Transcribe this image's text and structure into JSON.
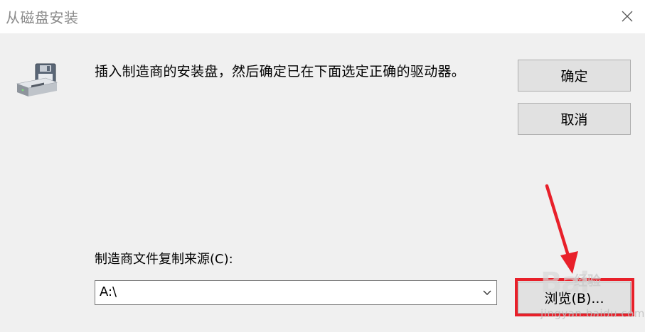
{
  "window": {
    "title": "从磁盘安装"
  },
  "icons": {
    "close": "close-icon",
    "disk": "floppy-disk-drive-icon",
    "dropdown": "chevron-down-icon"
  },
  "dialog": {
    "instruction": "插入制造商的安装盘，然后确定已在下面选定正确的驱动器。",
    "ok_label": "确定",
    "cancel_label": "取消",
    "source_label": "制造商文件复制来源(C):",
    "source_value": "A:\\",
    "browse_label": "浏览(B)..."
  },
  "annotation": {
    "highlight_color": "#e8202a",
    "arrow_color": "#e8202a"
  },
  "watermark": {
    "brand": "Bai",
    "sub": "经验",
    "url": "jingyan.baidu.com"
  }
}
